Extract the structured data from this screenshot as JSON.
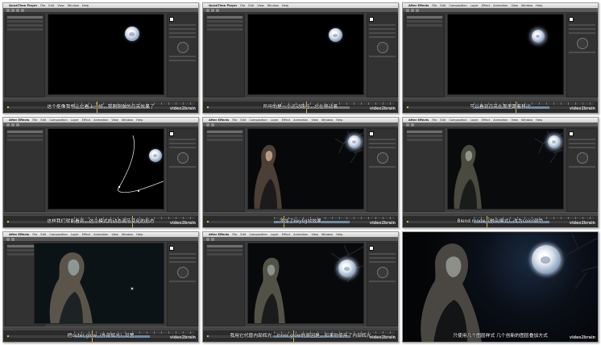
{
  "menus": {
    "quicktime": {
      "app": "QuickTime Player",
      "items": [
        "File",
        "Edit",
        "View",
        "Window",
        "Help"
      ]
    },
    "aftereffects": {
      "app": "After Effects",
      "items": [
        "File",
        "Edit",
        "Composition",
        "Layer",
        "Effect",
        "Animation",
        "View",
        "Window",
        "Help"
      ]
    }
  },
  "watermark": "video2brain",
  "frames": [
    {
      "menu": "quicktime",
      "subtitle": "这个抠像我想让它看上一帧，我刚刚做的月亮效果了"
    },
    {
      "menu": "quicktime",
      "subtitle": "所用的是一个运动路径，它在移动着"
    },
    {
      "menu": "aftereffects",
      "subtitle": "可以看到月亮在那里跟着移动"
    },
    {
      "menu": "aftereffects",
      "subtitle": "这样我们就能看到，这个模式的动态调节变化的形态"
    },
    {
      "menu": "aftereffects",
      "subtitle": "添加了keylight效果"
    },
    {
      "menu": "aftereffects",
      "subtitle": "Blend mode（融合模式）改为color颜色"
    },
    {
      "menu": "aftereffects",
      "subtitle": "把outer glow（外部辉光）设置"
    },
    {
      "menu": "aftereffects",
      "subtitle": "我用它代替内部辉光，inner glow的原因是，如果你使用了内部辉光"
    },
    {
      "menu": "none",
      "subtitle": "只使用几个图层样式 几个创新的图层叠加方式"
    }
  ]
}
